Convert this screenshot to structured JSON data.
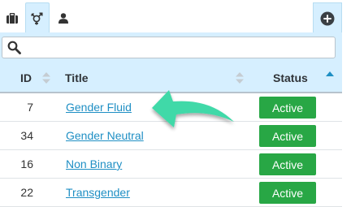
{
  "tabs": [
    {
      "icon": "briefcase-icon",
      "active": false
    },
    {
      "icon": "gender-icon",
      "active": true
    },
    {
      "icon": "user-icon",
      "active": false
    }
  ],
  "toolbar": {
    "add_icon": "plus-circle-icon"
  },
  "search": {
    "value": "",
    "placeholder": ""
  },
  "table": {
    "columns": [
      {
        "label": "ID",
        "sort": "none"
      },
      {
        "label": "Title",
        "sort": "none"
      },
      {
        "label": "Status",
        "sort": "ascending"
      }
    ],
    "rows": [
      {
        "id": "7",
        "title": "Gender Fluid",
        "status": "Active"
      },
      {
        "id": "34",
        "title": "Gender Neutral",
        "status": "Active"
      },
      {
        "id": "16",
        "title": "Non Binary",
        "status": "Active"
      },
      {
        "id": "22",
        "title": "Transgender",
        "status": "Active"
      }
    ]
  },
  "colors": {
    "header_bg": "#d6efff",
    "link": "#1f8fc4",
    "status_active": "#28a745",
    "pointer_arrow": "#3fd9a8"
  },
  "annotation": {
    "icon": "curved-arrow-pointer-icon"
  }
}
